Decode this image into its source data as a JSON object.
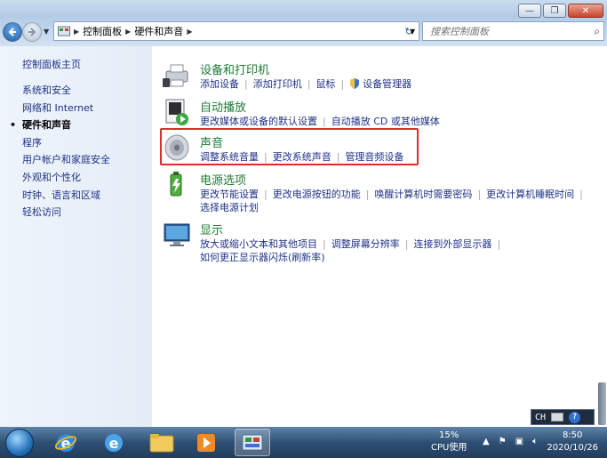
{
  "window": {
    "buttons": {
      "minimize": "—",
      "maximize": "❐",
      "close": "✕"
    }
  },
  "nav": {
    "breadcrumbs": [
      "控制面板",
      "硬件和声音"
    ],
    "search_placeholder": "搜索控制面板"
  },
  "sidebar": {
    "home": "控制面板主页",
    "items": [
      {
        "label": "系统和安全",
        "active": false
      },
      {
        "label": "网络和 Internet",
        "active": false
      },
      {
        "label": "硬件和声音",
        "active": true
      },
      {
        "label": "程序",
        "active": false
      },
      {
        "label": "用户帐户和家庭安全",
        "active": false
      },
      {
        "label": "外观和个性化",
        "active": false
      },
      {
        "label": "时钟、语言和区域",
        "active": false
      },
      {
        "label": "轻松访问",
        "active": false
      }
    ]
  },
  "categories": [
    {
      "title": "设备和打印机",
      "icon": "printer-icon",
      "links": [
        "添加设备",
        "添加打印机",
        "鼠标",
        "设备管理器"
      ]
    },
    {
      "title": "自动播放",
      "icon": "autoplay-icon",
      "links": [
        "更改媒体或设备的默认设置",
        "自动播放 CD 或其他媒体"
      ]
    },
    {
      "title": "声音",
      "icon": "speaker-icon",
      "links": [
        "调整系统音量",
        "更改系统声音",
        "管理音频设备"
      ],
      "highlighted": true
    },
    {
      "title": "电源选项",
      "icon": "power-icon",
      "links": [
        "更改节能设置",
        "更改电源按钮的功能",
        "唤醒计算机时需要密码",
        "更改计算机睡眠时间",
        "选择电源计划"
      ]
    },
    {
      "title": "显示",
      "icon": "display-icon",
      "links": [
        "放大或缩小文本和其他项目",
        "调整屏幕分辨率",
        "连接到外部显示器",
        "如何更正显示器闪烁(刷新率)"
      ]
    }
  ],
  "taskbar": {
    "cpu_percent": "15%",
    "cpu_label": "CPU使用",
    "time": "8:50",
    "date": "2020/10/26",
    "language": "CH",
    "help": "?"
  }
}
